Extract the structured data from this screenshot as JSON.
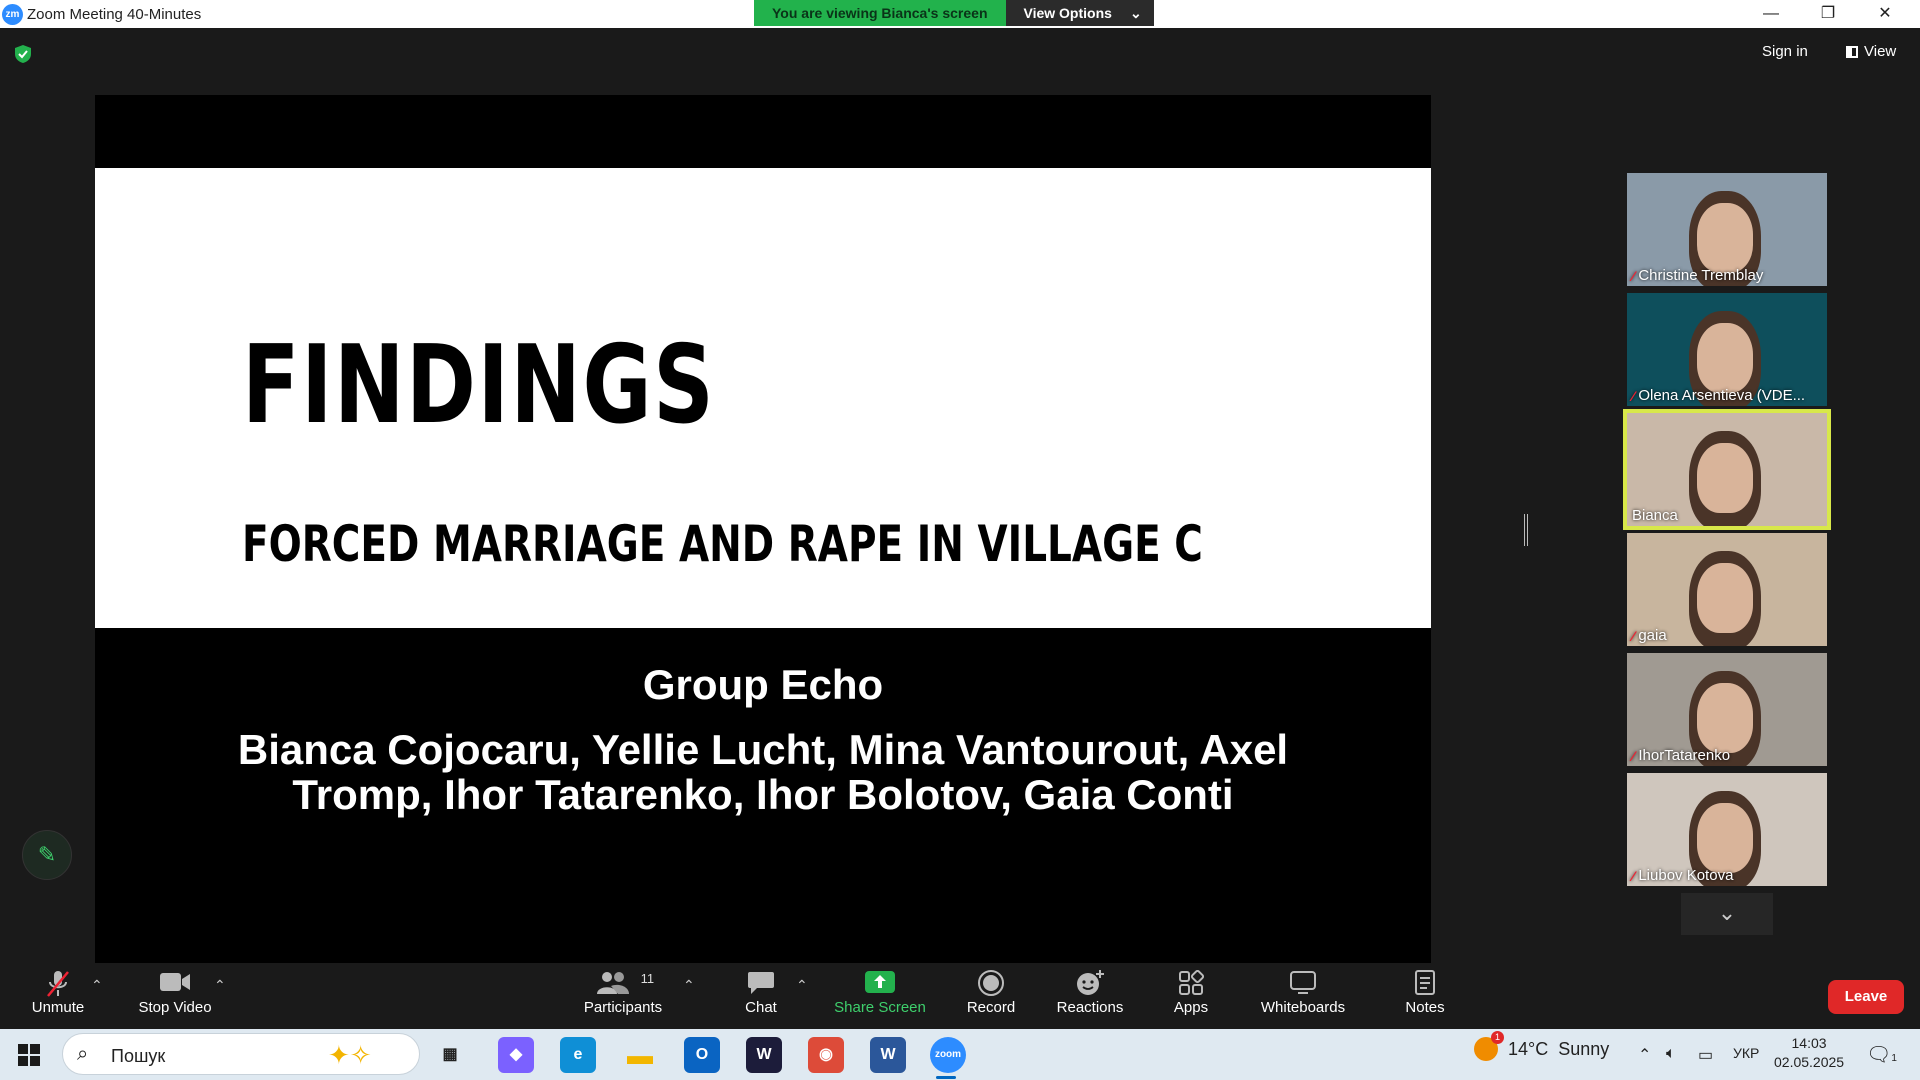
{
  "window": {
    "title": "Zoom Meeting 40-Minutes",
    "app_icon_text": "zm",
    "minimize": "—",
    "restore": "❐",
    "close": "✕"
  },
  "share_banner": {
    "viewing_text": "You are viewing Bianca's screen",
    "options_label": "View Options",
    "options_caret": "⌄"
  },
  "header": {
    "sign_in": "Sign in",
    "view": "View"
  },
  "slide": {
    "title": "FINDINGS",
    "subtitle": "FORCED MARRIAGE AND RAPE IN VILLAGE C",
    "group": "Group Echo",
    "members": "Bianca Cojocaru, Yellie Lucht, Mina Vantourout, Axel Tromp, Ihor Tatarenko, Ihor Bolotov, Gaia Conti"
  },
  "participants_gallery": [
    {
      "name": "Christine Tremblay",
      "muted": true,
      "bg": "#8a9aa8"
    },
    {
      "name": "Olena Arsentieva (VDE...",
      "muted": true,
      "bg": "#0e4f5c"
    },
    {
      "name": "Bianca",
      "muted": false,
      "bg": "#c9b8a8",
      "active": true
    },
    {
      "name": "gaia",
      "muted": true,
      "bg": "#c8b59e"
    },
    {
      "name": "IhorTatarenko",
      "muted": true,
      "bg": "#a09a92"
    },
    {
      "name": "Liubov Kotova",
      "muted": true,
      "bg": "#cfc6bd"
    }
  ],
  "gallery_scroll_icon": "⌄",
  "toolbar": {
    "unmute": "Unmute",
    "stop_video": "Stop Video",
    "participants": "Participants",
    "participants_count": "11",
    "chat": "Chat",
    "share_screen": "Share Screen",
    "record": "Record",
    "reactions": "Reactions",
    "apps": "Apps",
    "whiteboards": "Whiteboards",
    "notes": "Notes",
    "leave": "Leave",
    "caret": "⌃"
  },
  "taskbar": {
    "search_placeholder": "Пошук",
    "weather_temp": "14°C",
    "weather_desc": "Sunny",
    "weather_badge": "1",
    "language": "УКР",
    "time": "14:03",
    "date": "02.05.2025",
    "notification_count": "1",
    "apps": [
      {
        "name": "task-view",
        "glyph": "▦",
        "color": "#333333"
      },
      {
        "name": "copilot",
        "glyph": "◆",
        "color": "#7b61ff"
      },
      {
        "name": "edge",
        "glyph": "e",
        "color": "#0f8fd6"
      },
      {
        "name": "file-explorer",
        "glyph": "▬",
        "color": "#f2b600"
      },
      {
        "name": "outlook",
        "glyph": "O",
        "color": "#0a64c2"
      },
      {
        "name": "webex",
        "glyph": "W",
        "color": "#1c1c3a"
      },
      {
        "name": "chrome",
        "glyph": "◉",
        "color": "#dd4b39"
      },
      {
        "name": "word",
        "glyph": "W",
        "color": "#2b579a"
      },
      {
        "name": "zoom",
        "glyph": "zoom",
        "color": "#2d8cff"
      }
    ]
  }
}
